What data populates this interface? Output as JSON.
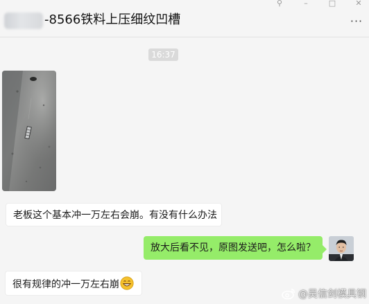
{
  "header": {
    "title": "-8566铁料上压细纹凹槽",
    "more_icon": "more-icon"
  },
  "window_controls": {
    "pin_icon": "pin-icon",
    "minimize_icon": "minimize-icon",
    "maximize_icon": "maximize-icon",
    "close_icon": "close-icon"
  },
  "chat": {
    "timestamp": "16:37",
    "messages": [
      {
        "sender": "other",
        "type": "image",
        "description_icon": "photo"
      },
      {
        "sender": "other",
        "type": "text",
        "text": "老板这个基本冲一万左右会崩。有没有什么办法"
      },
      {
        "sender": "self",
        "type": "text",
        "text": "放大后看不见，原图发送吧，怎么啦？"
      },
      {
        "sender": "other",
        "type": "text",
        "text": "很有规律的冲一万左右崩",
        "emoji": "grin-emoji"
      }
    ]
  },
  "watermark": {
    "text": "@吴信剑模具钢",
    "icon": "weibo-icon"
  },
  "colors": {
    "background": "#f5f5f5",
    "self_bubble": "#95ec69",
    "other_bubble": "#ffffff",
    "timestamp_bg": "#dadada"
  }
}
